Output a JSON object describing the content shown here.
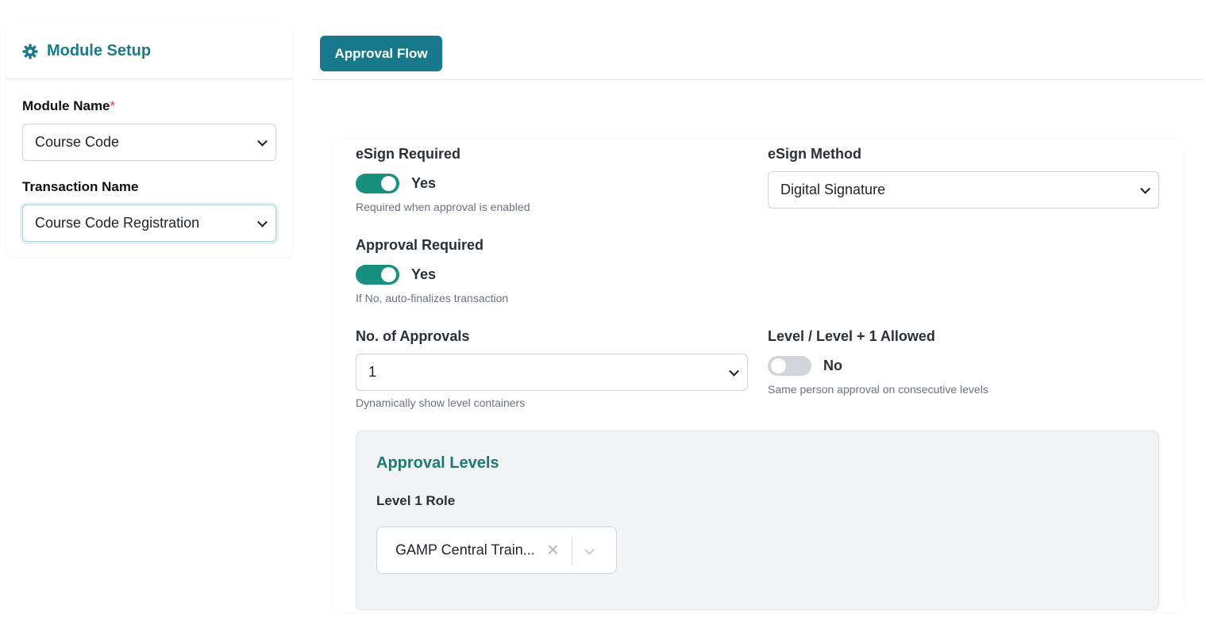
{
  "module_setup": {
    "title": "Module Setup",
    "icon": "gear-icon",
    "module_name_label": "Module Name",
    "required_mark": "*",
    "module_name_value": "Course Code",
    "transaction_name_label": "Transaction Name",
    "transaction_name_value": "Course Code Registration"
  },
  "tabs": {
    "approval_flow": "Approval Flow"
  },
  "form": {
    "esign_required_label": "eSign Required",
    "esign_required_state": "Yes",
    "esign_required_help": "Required when approval is enabled",
    "esign_method_label": "eSign Method",
    "esign_method_value": "Digital Signature",
    "approval_required_label": "Approval Required",
    "approval_required_state": "Yes",
    "approval_required_help": "If No, auto-finalizes transaction",
    "num_approvals_label": "No. of Approvals",
    "num_approvals_value": "1",
    "num_approvals_help": "Dynamically show level containers",
    "level_allowed_label": "Level / Level + 1 Allowed",
    "level_allowed_state": "No",
    "level_allowed_help": "Same person approval on consecutive levels"
  },
  "approval_levels": {
    "title": "Approval Levels",
    "level1_label": "Level 1 Role",
    "level1_value": "GAMP Central Train..."
  },
  "colors": {
    "accent": "#17798b",
    "toggle_on": "#17907f",
    "toggle_off": "#d1d5db",
    "required": "#dc3545"
  }
}
